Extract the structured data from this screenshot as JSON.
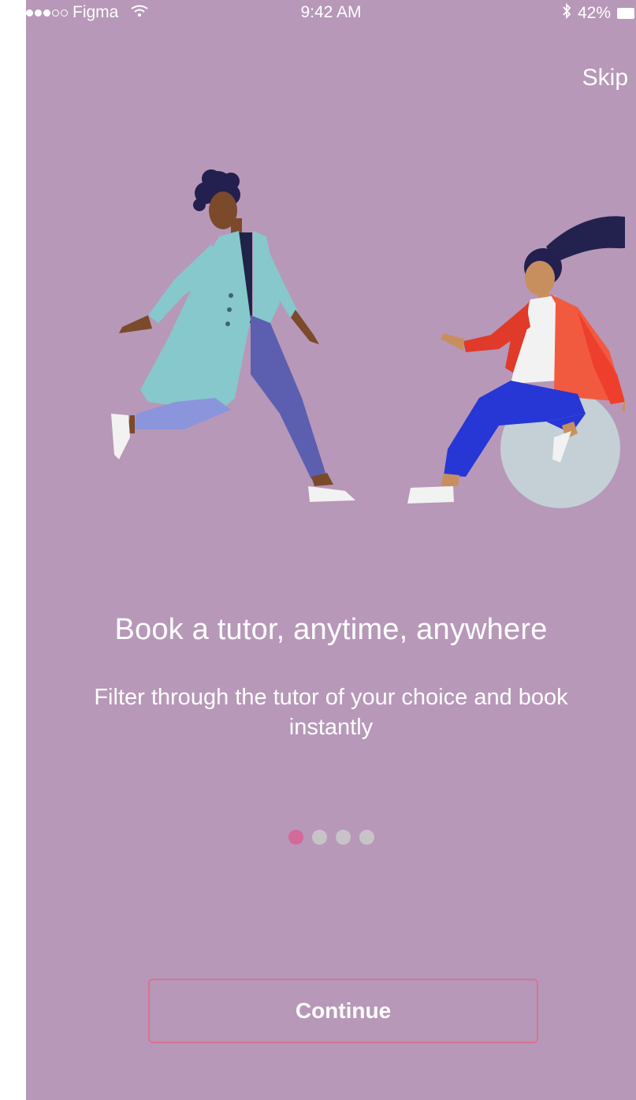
{
  "status_bar": {
    "carrier": "Figma",
    "time": "9:42 AM",
    "battery": "42%",
    "signal_dots_filled": 3,
    "signal_dots_total": 5,
    "icons": [
      "wifi-icon",
      "bluetooth-icon",
      "battery-icon"
    ]
  },
  "header": {
    "skip_label": "Skip"
  },
  "onboarding": {
    "title": "Book a tutor, anytime, anywhere",
    "subtitle": "Filter through the tutor of your choice and book instantly",
    "page_indicator": {
      "current": 1,
      "total": 4
    },
    "illustration": "two-people-meeting-illustration"
  },
  "actions": {
    "continue_label": "Continue"
  },
  "colors": {
    "background": "#b798b8",
    "text": "#ffffff",
    "accent": "#d26a9a",
    "button_border": "#d9738f",
    "inactive_dot": "#c8c3c9"
  }
}
